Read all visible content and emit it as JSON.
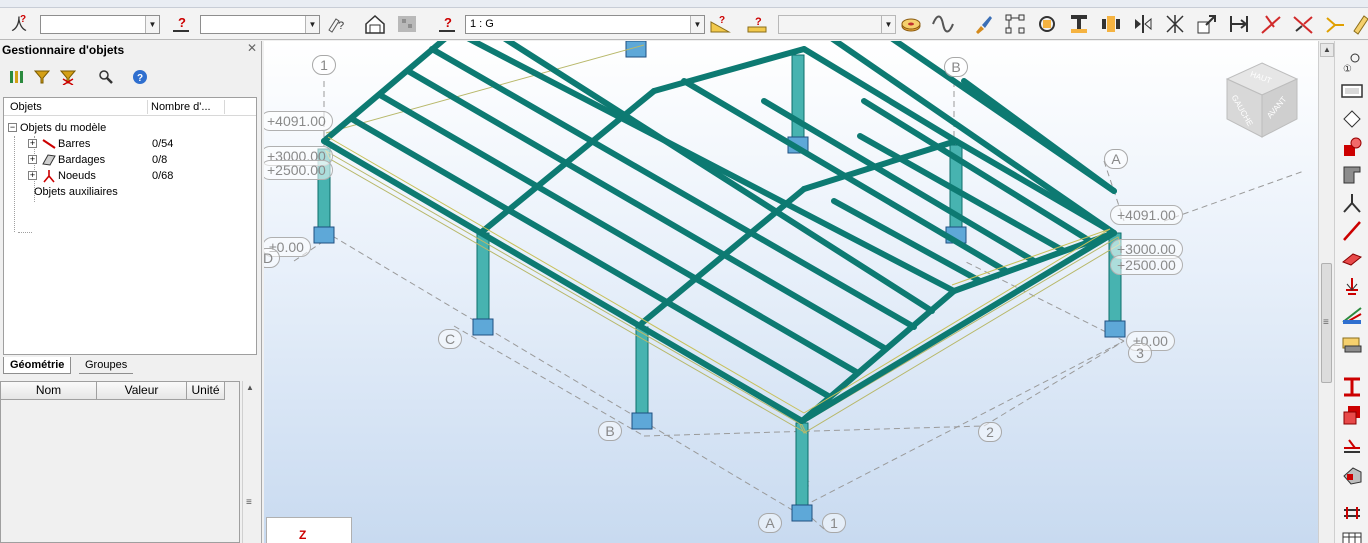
{
  "toolbar": {
    "combo_1_value": "",
    "combo_2_value": "",
    "combo_3_value": "1 : G",
    "combo_4_value": ""
  },
  "object_manager": {
    "title": "Gestionnaire d'objets",
    "columns": [
      "Objets",
      "Nombre d'..."
    ],
    "root": "Objets du modèle",
    "items": [
      {
        "label": "Barres",
        "count": "0/54"
      },
      {
        "label": "Bardages",
        "count": "0/8"
      },
      {
        "label": "Noeuds",
        "count": "0/68"
      }
    ],
    "aux": "Objets auxiliaires",
    "tabs": [
      "Géométrie",
      "Groupes"
    ]
  },
  "properties": {
    "columns": [
      "Nom",
      "Valeur",
      "Unité"
    ]
  },
  "viewport": {
    "view_cube": {
      "top": "HAUT",
      "left": "GAUCHE",
      "front": "AVANT"
    },
    "elevations": [
      "+4091.00",
      "+3000.00",
      "+2500.00",
      "±0.00",
      "+4091.00",
      "+3000.00",
      "+2500.00",
      "±0.00"
    ],
    "grid_labels": [
      "1",
      "B",
      "A",
      "D",
      "C",
      "B",
      "2",
      "A",
      "1",
      "3"
    ],
    "axis_label": "Z",
    "colors": {
      "frame": "#0d7a72",
      "column": "#47b3b0",
      "column_base": "#5ea8d8"
    }
  }
}
